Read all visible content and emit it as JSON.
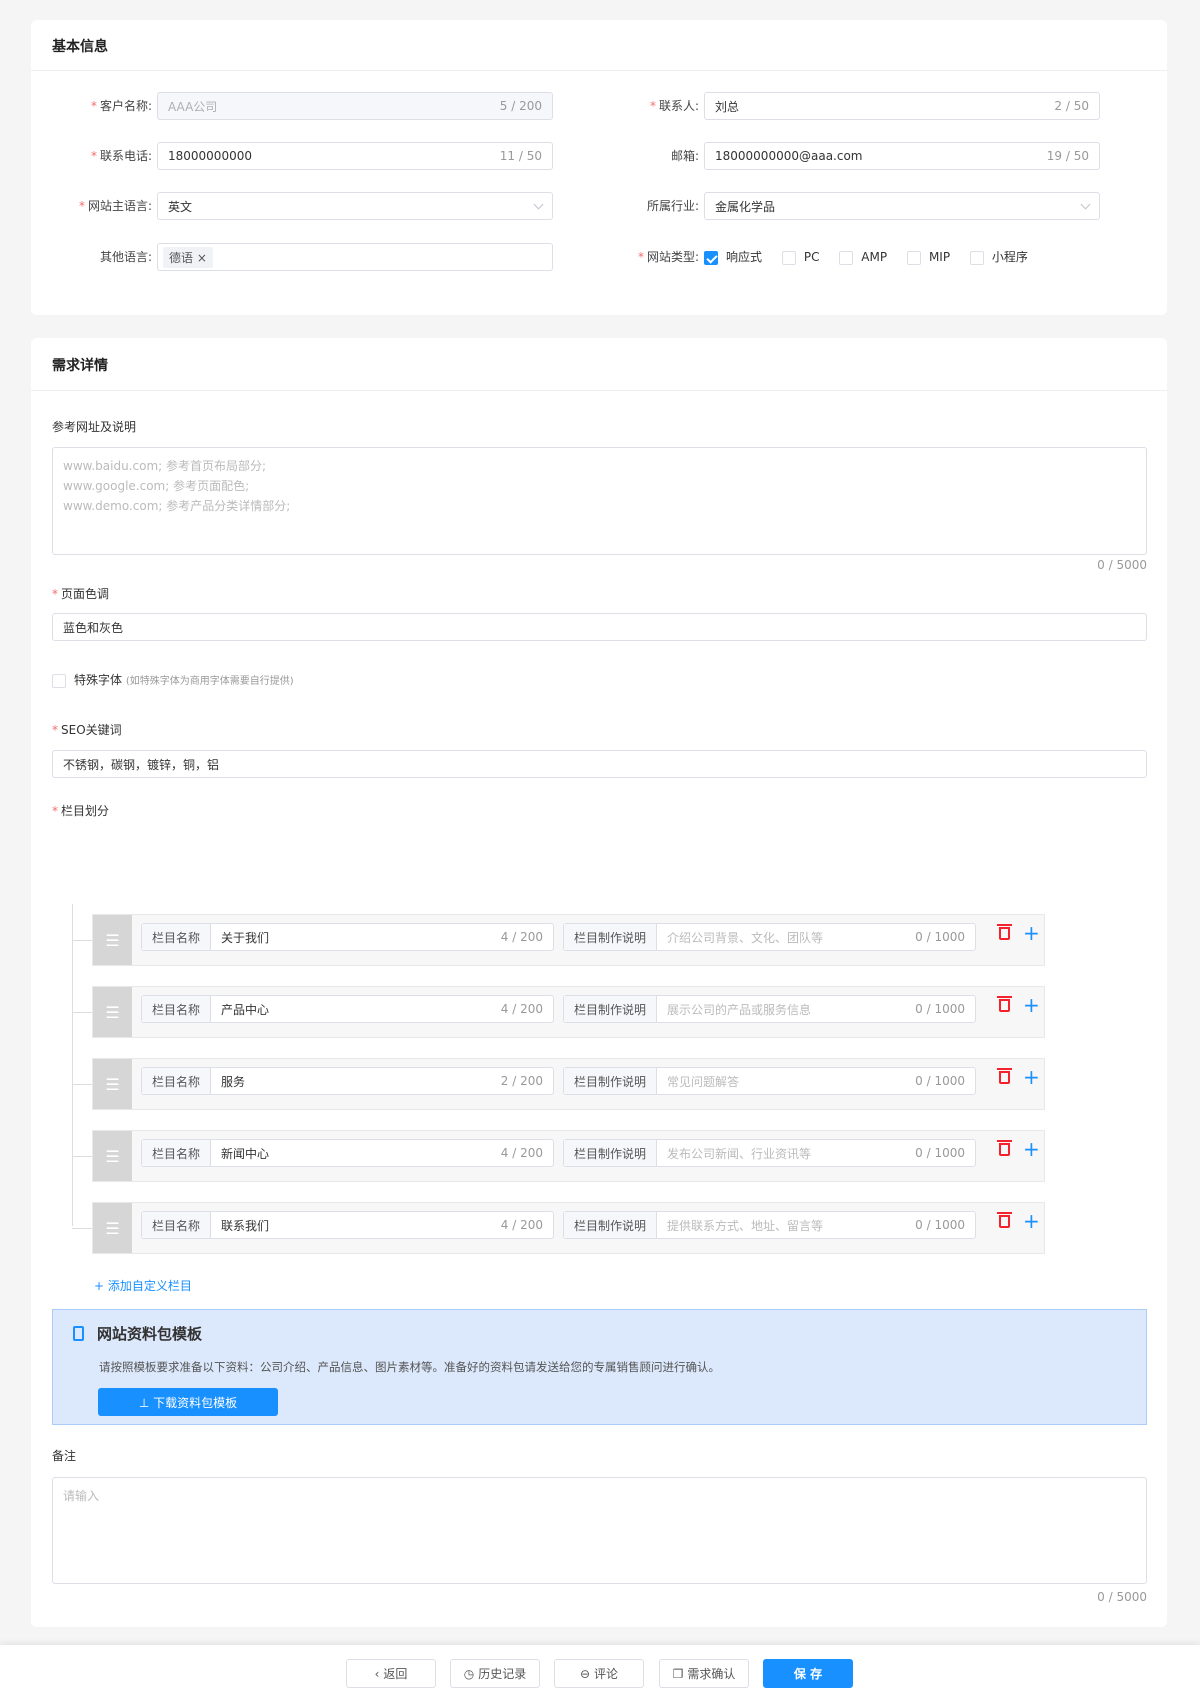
{
  "basic": {
    "title": "基本信息",
    "customer_name": {
      "label": "客户名称:",
      "value": "AAA公司",
      "count": "5 / 200"
    },
    "phone": {
      "label": "联系电话:",
      "value": "18000000000",
      "count": "11 / 50"
    },
    "main_lang": {
      "label": "网站主语言:",
      "value": "英文"
    },
    "other_lang": {
      "label": "其他语言:",
      "tag": "德语"
    },
    "contact": {
      "label": "联系人:",
      "value": "刘总",
      "count": "2 / 50"
    },
    "email": {
      "label": "邮箱:",
      "value": "18000000000@aaa.com",
      "count": "19 / 50"
    },
    "industry": {
      "label": "所属行业:",
      "value": "金属化学品"
    },
    "site_type": {
      "label": "网站类型:",
      "options": [
        {
          "label": "响应式",
          "checked": true
        },
        {
          "label": "PC",
          "checked": false
        },
        {
          "label": "AMP",
          "checked": false
        },
        {
          "label": "MIP",
          "checked": false
        },
        {
          "label": "小程序",
          "checked": false
        }
      ]
    }
  },
  "detail": {
    "title": "需求详情",
    "ref": {
      "label": "参考网址及说明",
      "placeholder": [
        "www.baidu.com; 参考首页布局部分;",
        "www.google.com; 参考页面配色;",
        "www.demo.com; 参考产品分类详情部分;"
      ],
      "count": "0 / 5000"
    },
    "color": {
      "label": "页面色调",
      "value": "蓝色和灰色"
    },
    "font": {
      "label": "特殊字体",
      "hint": "(如特殊字体为商用字体需要自行提供)"
    },
    "seo": {
      "label": "SEO关键词",
      "value": "不锈钢，碳钢，镀锌，铜，铝"
    },
    "columns": {
      "label": "栏目划分",
      "name_prefix": "栏目名称",
      "desc_prefix": "栏目制作说明",
      "items": [
        {
          "name": "关于我们",
          "count": "4 / 200",
          "desc_ph": "介绍公司背景、文化、团队等",
          "desc_count": "0 / 1000"
        },
        {
          "name": "产品中心",
          "count": "4 / 200",
          "desc_ph": "展示公司的产品或服务信息",
          "desc_count": "0 / 1000"
        },
        {
          "name": "服务",
          "count": "2 / 200",
          "desc_ph": "常见问题解答",
          "desc_count": "0 / 1000"
        },
        {
          "name": "新闻中心",
          "count": "4 / 200",
          "desc_ph": "发布公司新闻、行业资讯等",
          "desc_count": "0 / 1000"
        },
        {
          "name": "联系我们",
          "count": "4 / 200",
          "desc_ph": "提供联系方式、地址、留言等",
          "desc_count": "0 / 1000"
        }
      ],
      "add": "+ 添加自定义栏目"
    },
    "banner": {
      "title": "网站资料包模板",
      "desc": "请按照模板要求准备以下资料：公司介绍、产品信息、图片素材等。准备好的资料包请发送给您的专属销售顾问进行确认。",
      "button": "⊥ 下载资料包模板"
    },
    "remark": {
      "label": "备注",
      "placeholder": "请输入",
      "count": "0 / 5000"
    }
  },
  "footer": {
    "back": "返回",
    "history": "历史记录",
    "comment": "评论",
    "confirm": "需求确认",
    "save": "保 存"
  },
  "colors": {
    "primary": "#1890ff",
    "danger": "#f5222d",
    "banner_bg": "#dce8fb"
  }
}
